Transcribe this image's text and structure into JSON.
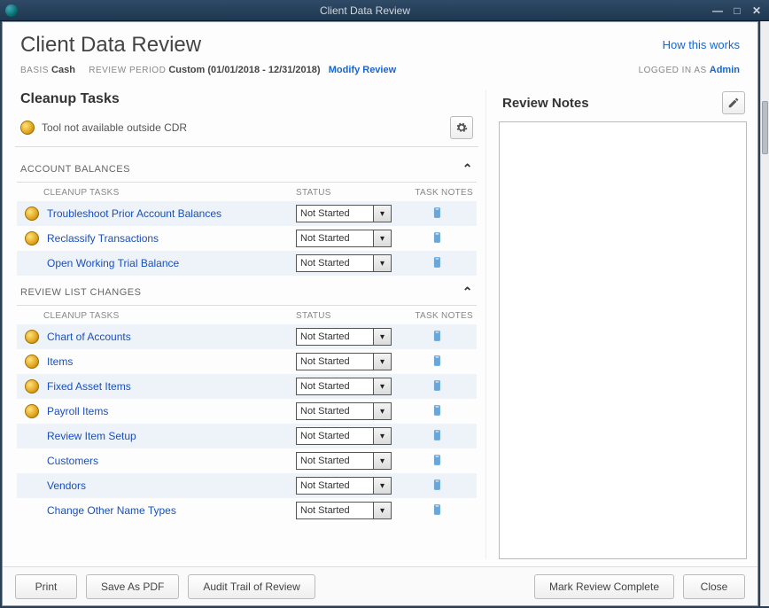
{
  "window": {
    "title": "Client Data Review"
  },
  "header": {
    "page_title": "Client Data Review",
    "how_this_works": "How this works"
  },
  "meta": {
    "basis_label": "BASIS",
    "basis_value": "Cash",
    "period_label": "REVIEW PERIOD",
    "period_value": "Custom (01/01/2018 - 12/31/2018)",
    "modify_review": "Modify Review",
    "logged_in_label": "LOGGED IN AS",
    "logged_in_user": "Admin"
  },
  "cleanup": {
    "title": "Cleanup Tasks",
    "tool_note": "Tool not available outside CDR",
    "col_tasks": "CLEANUP TASKS",
    "col_status": "STATUS",
    "col_notes": "TASK NOTES",
    "status_default": "Not Started",
    "groups": [
      {
        "name": "ACCOUNT BALANCES",
        "rows": [
          {
            "label": "Troubleshoot Prior Account Balances",
            "coin": true
          },
          {
            "label": "Reclassify Transactions",
            "coin": true
          },
          {
            "label": "Open Working Trial Balance",
            "coin": false
          }
        ]
      },
      {
        "name": "REVIEW LIST CHANGES",
        "rows": [
          {
            "label": "Chart of Accounts",
            "coin": true
          },
          {
            "label": "Items",
            "coin": true
          },
          {
            "label": "Fixed Asset Items",
            "coin": true
          },
          {
            "label": "Payroll Items",
            "coin": true
          },
          {
            "label": "Review Item Setup",
            "coin": false
          },
          {
            "label": "Customers",
            "coin": false
          },
          {
            "label": "Vendors",
            "coin": false
          },
          {
            "label": "Change Other Name Types",
            "coin": false
          }
        ]
      }
    ]
  },
  "notes": {
    "title": "Review Notes"
  },
  "buttons": {
    "print": "Print",
    "save_pdf": "Save As PDF",
    "audit": "Audit Trail of Review",
    "complete": "Mark Review Complete",
    "close": "Close"
  }
}
